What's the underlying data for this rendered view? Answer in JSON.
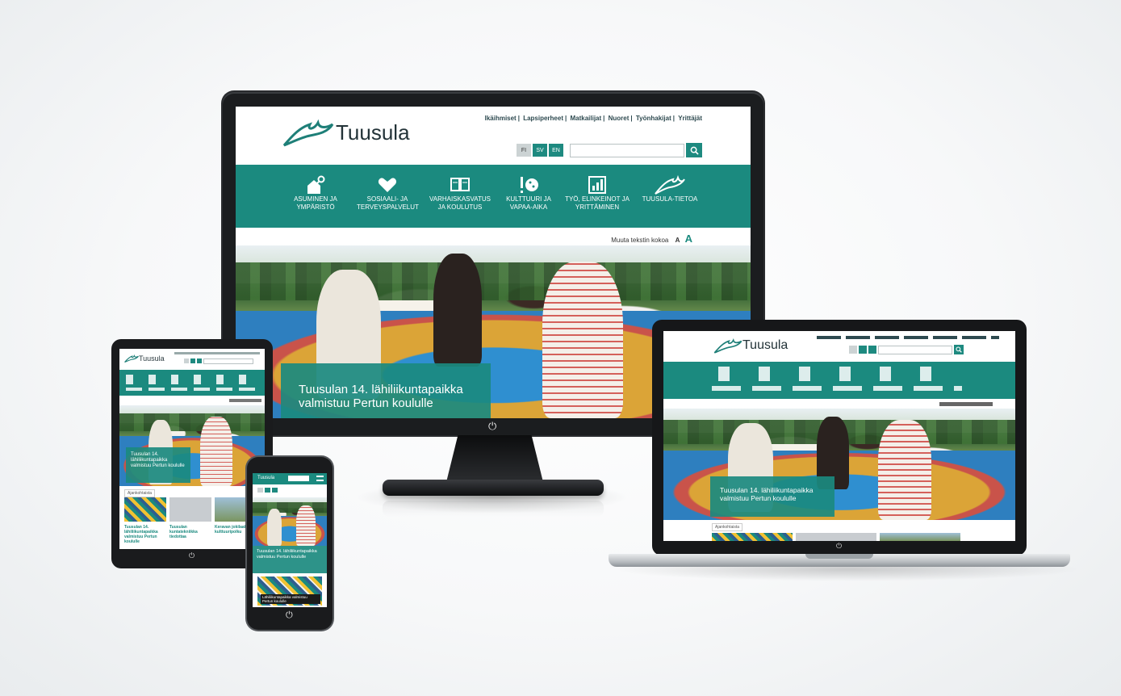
{
  "site": {
    "logo_text": "Tuusula",
    "top_links": [
      "Ikäihmiset",
      "Lapsiperheet",
      "Matkailijat",
      "Nuoret",
      "Työnhakijat",
      "Yrittäjät"
    ],
    "lang": [
      "FI",
      "SV",
      "EN"
    ],
    "lang_selected": "FI",
    "search_placeholder": "",
    "nav": [
      {
        "icon": "house-key-icon",
        "label": "ASUMINEN JA YMPÄRISTÖ"
      },
      {
        "icon": "heart-hands-icon",
        "label": "SOSIAALI- JA TERVEYSPALVELUT"
      },
      {
        "icon": "book-icon",
        "label": "VARHAISKASVATUS JA KOULUTUS"
      },
      {
        "icon": "culture-palette-icon",
        "label": "KULTTUURI JA VAPAA-AIKA"
      },
      {
        "icon": "chart-icon",
        "label": "TYÖ, ELINKEINOT JA YRITTÄMINEN"
      },
      {
        "icon": "tuusula-leaf-icon",
        "label": "TUUSULA-TIETOA"
      }
    ],
    "text_size_label": "Muuta tekstin kokoa",
    "text_size_small": "A",
    "text_size_large": "A",
    "hero_caption": "Tuusulan 14. lähiliikuntapaikka valmistuu Pertun koululle"
  },
  "tablet": {
    "hero_caption": "Tuusulan 14. lähiliikuntapaikka valmistuu Pertun koululle",
    "news_tab": "Ajankohtaista",
    "news": [
      {
        "title": "Tuusulan 14. lähiliikuntapaikka valmistuu Pertun koululle"
      },
      {
        "title": "Tuusulan kuntatekniikka tiedottaa"
      },
      {
        "title": "Keravan jokilaakson kulttuuripolku"
      }
    ]
  },
  "phone": {
    "hero_caption": "Tuusulan 14. lähiliikuntapaikka valmistuu Pertun koululle",
    "promo_caption": "Lähiliikuntapaikka valmistuu Pertun koululle"
  },
  "laptop": {
    "news_tab": "Ajankohtaista"
  },
  "colors": {
    "brand_teal": "#1b8a7f",
    "device_black": "#1a1b1d"
  }
}
